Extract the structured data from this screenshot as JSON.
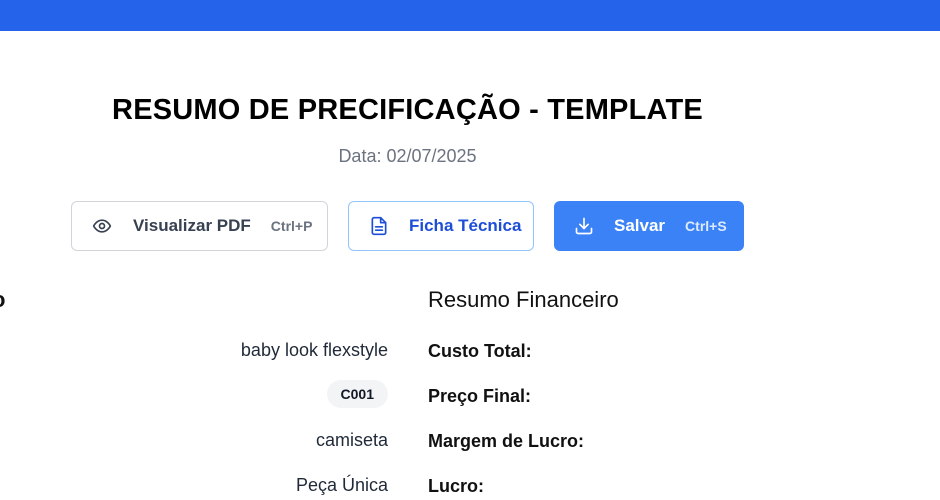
{
  "header": {
    "title": "RESUMO DE PRECIFICAÇÃO - TEMPLATE",
    "date": "Data: 02/07/2025"
  },
  "toolbar": {
    "pdf_label": "Visualizar PDF",
    "pdf_shortcut": "Ctrl+P",
    "ficha_label": "Ficha Técnica",
    "save_label": "Salvar",
    "save_shortcut": "Ctrl+S"
  },
  "product": {
    "heading_fragment": "o",
    "name": "baby look flexstyle",
    "code": "C001",
    "category": "camiseta",
    "size": "Peça Única"
  },
  "financial": {
    "heading": "Resumo Financeiro",
    "total_cost_label": "Custo Total:",
    "final_price_label": "Preço Final:",
    "margin_label": "Margem de Lucro:",
    "profit_label": "Lucro:"
  },
  "colors": {
    "topbar": "#2563eb",
    "primary_button": "#3b82f6",
    "secondary_button_text": "#1d4ed8"
  },
  "icons": {
    "pdf": "eye-icon",
    "ficha": "document-icon",
    "save": "download-icon"
  }
}
